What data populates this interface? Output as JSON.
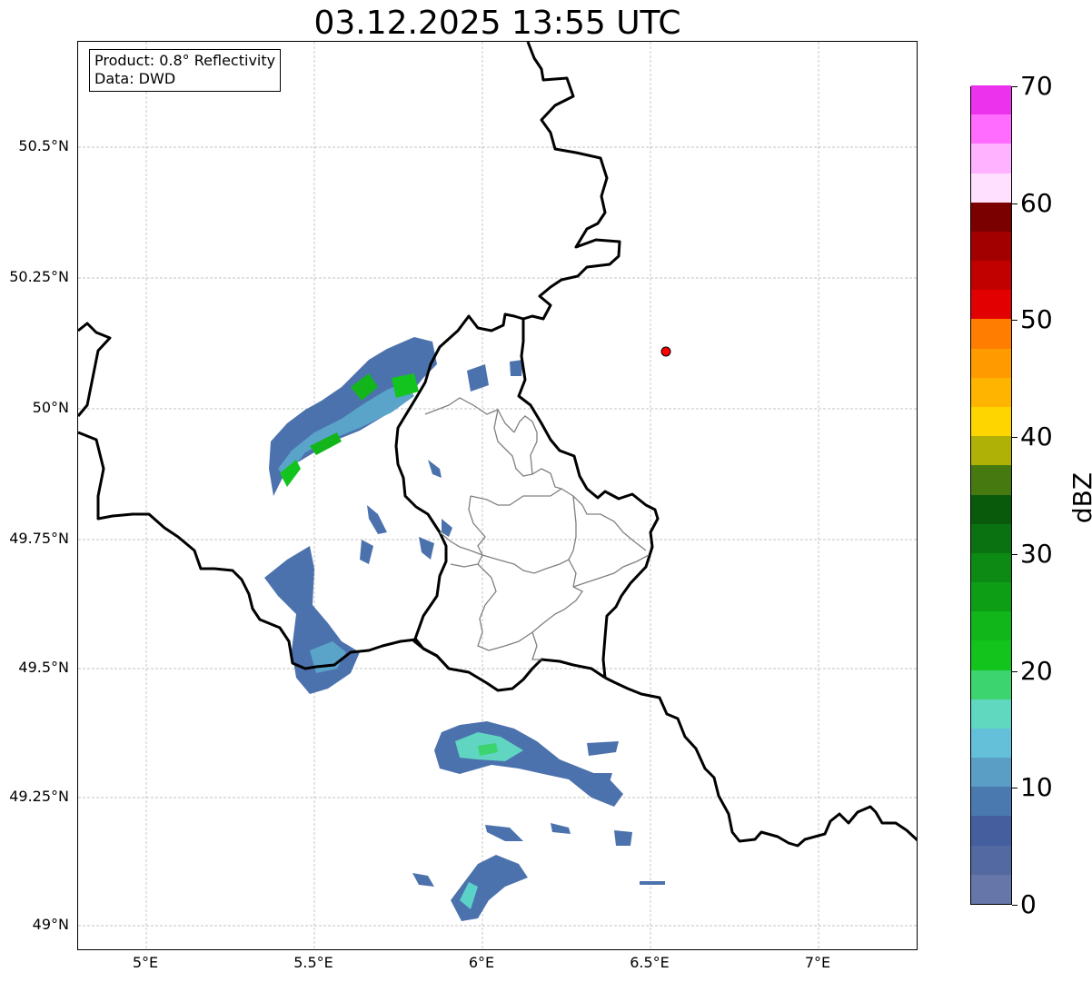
{
  "title": "03.12.2025 13:55 UTC",
  "info": {
    "product": "Product: 0.8° Reflectivity",
    "data_source": "Data: DWD"
  },
  "axes": {
    "lat_ticks": [
      "50.5°N",
      "50.25°N",
      "50°N",
      "49.75°N",
      "49.5°N",
      "49.25°N",
      "49°N"
    ],
    "lon_ticks": [
      "5°E",
      "5.5°E",
      "6°E",
      "6.5°E",
      "7°E"
    ],
    "lon_range": [
      4.8,
      7.3
    ],
    "lat_range": [
      48.95,
      50.7
    ],
    "grid": true
  },
  "marker": {
    "lon": 6.55,
    "lat": 50.11,
    "color": "#ff0000"
  },
  "colorbar": {
    "unit": "dBZ",
    "tick_labels": [
      "0",
      "10",
      "20",
      "30",
      "40",
      "50",
      "60",
      "70"
    ],
    "range": [
      0,
      70
    ],
    "colors": [
      "#6676a8",
      "#5369a1",
      "#455f9e",
      "#4a79b0",
      "#5a9ec5",
      "#64c0d8",
      "#60d8c0",
      "#3cd46e",
      "#12c41c",
      "#10b61a",
      "#0e9e16",
      "#0c8a14",
      "#0a7210",
      "#0a5a0c",
      "#467a10",
      "#afb107",
      "#ffd500",
      "#ffb500",
      "#ff9a00",
      "#ff7d00",
      "#e20000",
      "#c10000",
      "#a20000",
      "#7a0000",
      "#ffe0ff",
      "#ffb2ff",
      "#ff6cff",
      "#ec32ec"
    ]
  }
}
